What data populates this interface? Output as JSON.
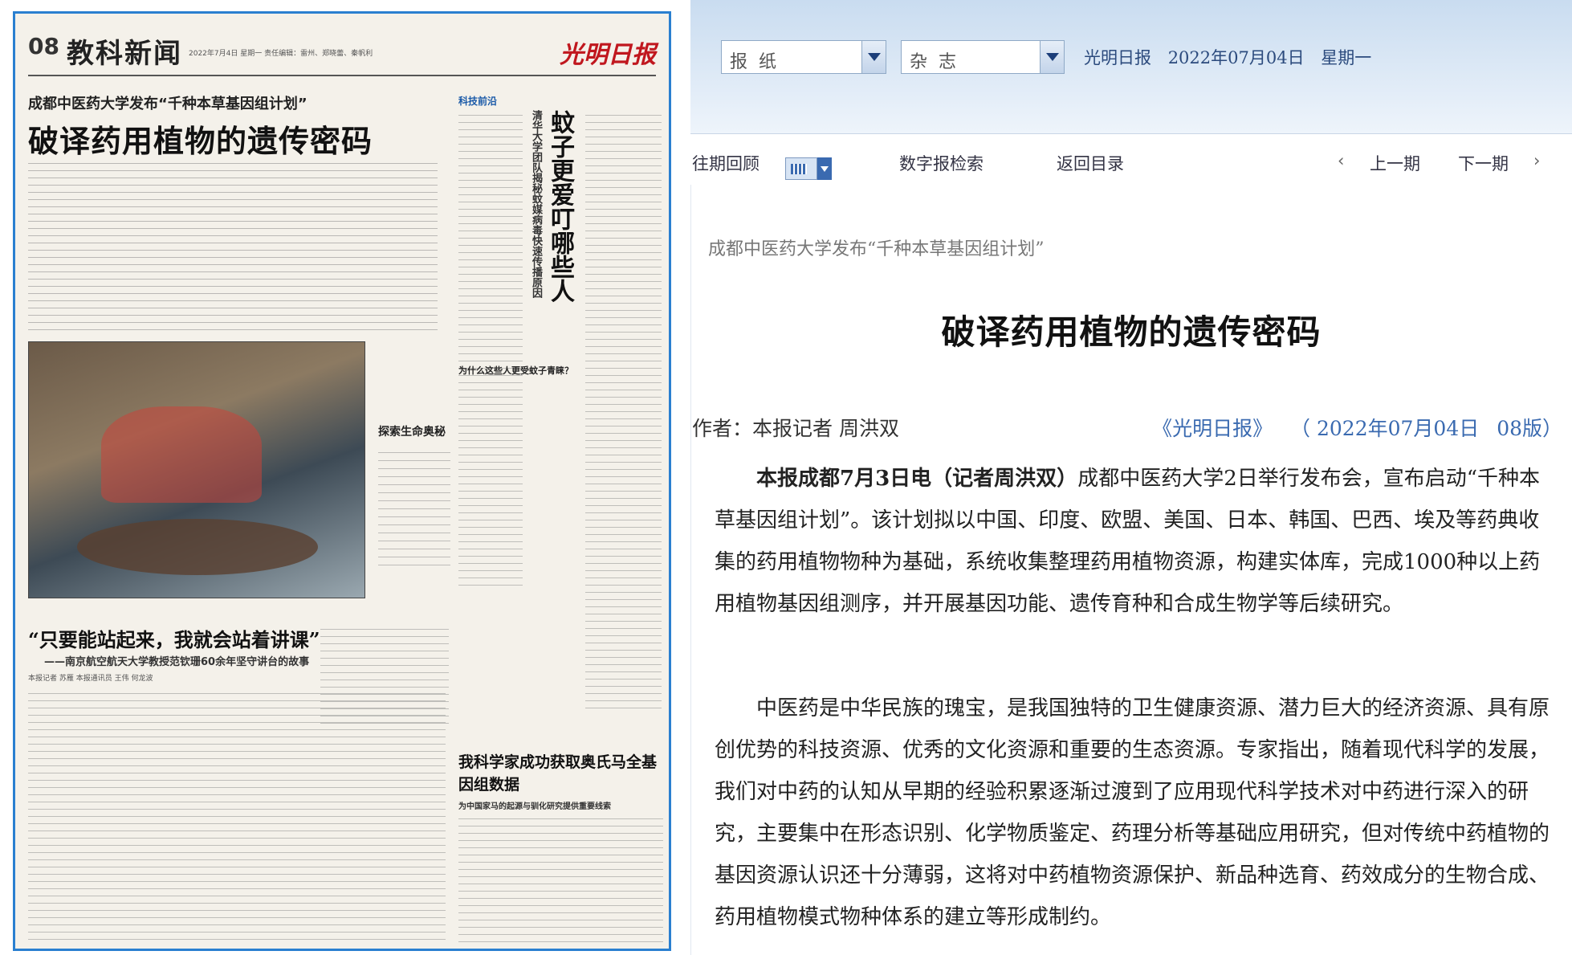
{
  "newspaper": {
    "page_no": "08",
    "section": "教科新闻",
    "meta": "2022年7月4日  星期一  责任编辑：雷州、郑晓蕾、秦帆利",
    "logo": "光明日报",
    "kicker": "成都中医药大学发布“千种本草基因组计划”",
    "headline": "破译药用植物的遗传密码",
    "tag": "科技前沿",
    "vertical_headline": "蚊子更爱叮哪些人",
    "vertical_sub": "清华大学团队揭秘蚊媒病毒快速传播原因",
    "sub_heading_1": "为什么这些人更受蚊子青睐？",
    "photo_caption_title": "探索生命奥秘",
    "headline_2": "“只要能站起来，我就会站着讲课”",
    "headline_2_sub": "——南京航空航天大学教授范钦珊60余年坚守讲台的故事",
    "byline_2": "本报记者  苏雁  本报通讯员  王伟  何龙波",
    "headline_3": "我科学家成功获取奥氏马全基因组数据",
    "headline_3_sub": "为中国家马的起源与驯化研究提供重要线索"
  },
  "selectors": {
    "newspaper_label": "报纸",
    "magazine_label": "杂志"
  },
  "date_line": {
    "publication": "光明日报",
    "date": "2022年07月04日",
    "weekday": "星期一"
  },
  "nav": {
    "archive": "往期回顾",
    "digital_search": "数字报检索",
    "back_to_index": "返回目录",
    "prev_issue": "上一期",
    "next_issue": "下一期"
  },
  "article": {
    "kicker": "成都中医药大学发布“千种本草基因组计划”",
    "title": "破译药用植物的遗传密码",
    "author": "作者：本报记者  周洪双",
    "source_paper": "《光明日报》",
    "source_date": "（ 2022年07月04日",
    "source_page": "08版）",
    "p1_lead": "本报成都7月3日电（记者周洪双）",
    "p1_body": "成都中医药大学2日举行发布会，宣布启动“千种本草基因组计划”。该计划拟以中国、印度、欧盟、美国、日本、韩国、巴西、埃及等药典收集的药用植物物种为基础，系统收集整理药用植物资源，构建实体库，完成1000种以上药用植物基因组测序，并开展基因功能、遗传育种和合成生物学等后续研究。",
    "p2": "中医药是中华民族的瑰宝，是我国独特的卫生健康资源、潜力巨大的经济资源、具有原创优势的科技资源、优秀的文化资源和重要的生态资源。专家指出，随着现代科学的发展，我们对中药的认知从早期的经验积累逐渐过渡到了应用现代科学技术对中药进行深入的研究，主要集中在形态识别、化学物质鉴定、药理分析等基础应用研究，但对传统中药植物的基因资源认识还十分薄弱，这将对中药植物资源保护、新品种选育、药效成分的生物合成、药用植物模式物种体系的建立等形成制约。"
  },
  "colors": {
    "frame_border": "#2a7fd0",
    "link_blue": "#3a6ab0",
    "logo_red": "#c0171e"
  }
}
